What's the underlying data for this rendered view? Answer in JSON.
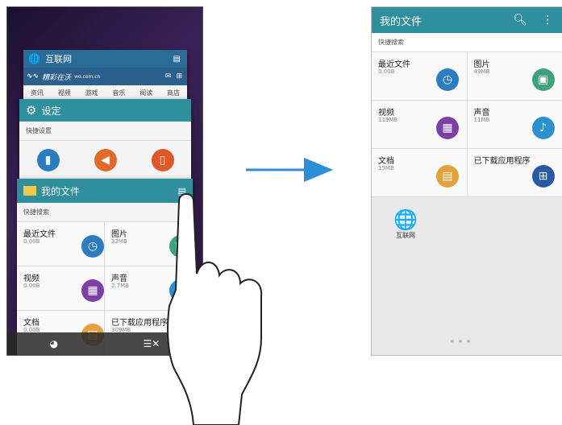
{
  "left_screen": {
    "browser_card": {
      "title": "互联网",
      "banner_text": "精彩在沃",
      "banner_sub": "wo.com.cn",
      "tabs": [
        "资讯",
        "视频",
        "游戏",
        "音乐",
        "阅读",
        "商店"
      ]
    },
    "settings_card": {
      "title": "设定",
      "subhead": "快捷设置"
    },
    "files_card": {
      "title": "我的文件",
      "subhead": "快捷搜索",
      "items": [
        {
          "label": "最近文件",
          "size": "0.00B",
          "icon": "clock-icon",
          "color": "#2b7cc0"
        },
        {
          "label": "图片",
          "size": "32MB",
          "icon": "image-icon",
          "color": "#3aa37a"
        },
        {
          "label": "视频",
          "size": "0.00B",
          "icon": "video-icon",
          "color": "#7b3fa5"
        },
        {
          "label": "声音",
          "size": "2.7MB",
          "icon": "music-icon",
          "color": "#2b8fd0"
        },
        {
          "label": "文档",
          "size": "0.00B",
          "icon": "document-icon",
          "color": "#e3a33a"
        },
        {
          "label": "已下载应用程序",
          "size": "309MB",
          "icon": "apps-icon",
          "color": "#2b5aa5"
        }
      ]
    }
  },
  "right_screen": {
    "title": "我的文件",
    "subhead": "快捷搜索",
    "items": [
      {
        "label": "最近文件",
        "size": "0.00B",
        "icon": "clock-icon",
        "color": "#2b7cc0"
      },
      {
        "label": "图片",
        "size": "49MB",
        "icon": "image-icon",
        "color": "#3aa37a"
      },
      {
        "label": "视频",
        "size": "119MB",
        "icon": "video-icon",
        "color": "#7b3fa5"
      },
      {
        "label": "声音",
        "size": "11MB",
        "icon": "music-icon",
        "color": "#2b8fd0"
      },
      {
        "label": "文档",
        "size": "15MB",
        "icon": "document-icon",
        "color": "#e3a33a"
      },
      {
        "label": "已下载应用程序",
        "size": "",
        "icon": "apps-icon",
        "color": "#2b5aa5"
      }
    ],
    "home_app": {
      "label": "互联网",
      "icon": "globe-icon"
    }
  },
  "colors": {
    "accent": "#2f8f9d",
    "arrow": "#2a8fd6"
  }
}
